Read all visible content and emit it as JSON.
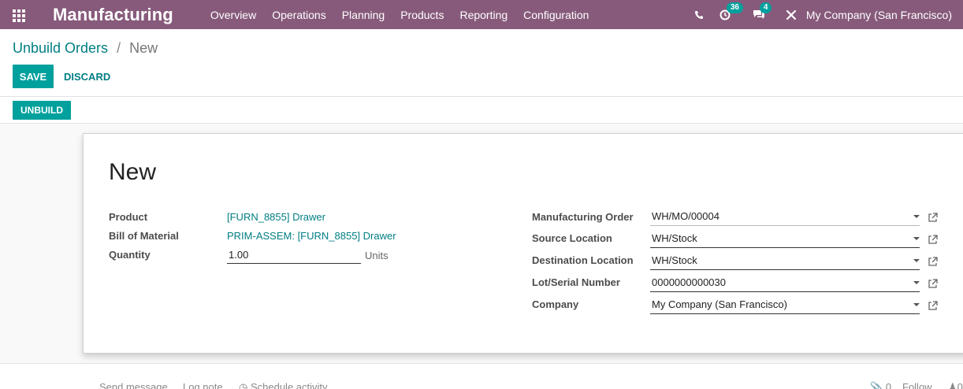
{
  "navbar": {
    "app_name": "Manufacturing",
    "menu": [
      "Overview",
      "Operations",
      "Planning",
      "Products",
      "Reporting",
      "Configuration"
    ],
    "activity_count": "36",
    "message_count": "4",
    "company": "My Company (San Francisco)",
    "icons": [
      "apps-icon",
      "phone-icon",
      "activity-icon",
      "messages-icon",
      "debug-tools-icon"
    ]
  },
  "breadcrumb": {
    "parent": "Unbuild Orders",
    "separator": "/",
    "current": "New"
  },
  "buttons": {
    "save": "SAVE",
    "discard": "DISCARD",
    "unbuild": "UNBUILD"
  },
  "form": {
    "title": "New",
    "left": {
      "product_label": "Product",
      "product_value": "[FURN_8855] Drawer",
      "bom_label": "Bill of Material",
      "bom_value": "PRIM-ASSEM: [FURN_8855] Drawer",
      "quantity_label": "Quantity",
      "quantity_value": "1.00",
      "quantity_uom": "Units"
    },
    "right": {
      "mo_label": "Manufacturing Order",
      "mo_value": "WH/MO/00004",
      "source_label": "Source Location",
      "source_value": "WH/Stock",
      "dest_label": "Destination Location",
      "dest_value": "WH/Stock",
      "lot_label": "Lot/Serial Number",
      "lot_value": "0000000000030",
      "company_label": "Company",
      "company_value": "My Company (San Francisco)"
    }
  },
  "chatter": {
    "send_message": "Send message",
    "log_note": "Log note",
    "schedule_activity": "Schedule activity",
    "attachments": "0",
    "follow": "Follow",
    "followers": "0"
  },
  "colors": {
    "navbar": "#875a7b",
    "primary": "#00a09d",
    "link": "#017e84"
  }
}
